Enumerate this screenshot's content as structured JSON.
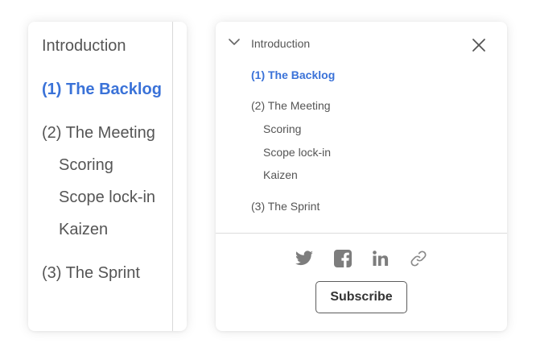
{
  "left_toc": {
    "items": [
      {
        "label": "Introduction"
      },
      {
        "label": "(1) The Backlog"
      },
      {
        "label": "(2) The Meeting"
      },
      {
        "label": "Scoring"
      },
      {
        "label": "Scope lock-in"
      },
      {
        "label": "Kaizen"
      },
      {
        "label": "(3) The Sprint"
      }
    ],
    "active_index": 1
  },
  "right_panel": {
    "section_title": "Introduction",
    "items": [
      {
        "label": "(1) The Backlog"
      },
      {
        "label": "(2) The Meeting"
      },
      {
        "label": "Scoring"
      },
      {
        "label": "Scope lock-in"
      },
      {
        "label": "Kaizen"
      },
      {
        "label": "(3) The Sprint"
      }
    ],
    "active_index": 0,
    "share_icons": [
      "twitter-icon",
      "facebook-icon",
      "linkedin-icon",
      "link-icon"
    ],
    "subscribe_label": "Subscribe"
  },
  "colors": {
    "accent": "#3a72d8",
    "text": "#555555",
    "icon": "#7d7d7d",
    "divider": "#d9d9d9"
  }
}
